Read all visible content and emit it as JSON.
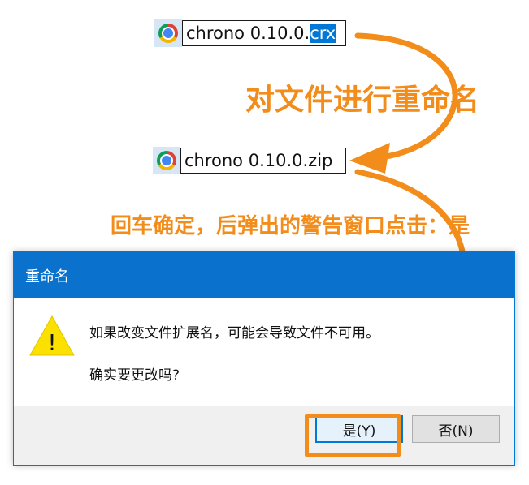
{
  "file_before": {
    "name_prefix": "chrono 0.10.0.",
    "extension_selected": "crx"
  },
  "file_after": {
    "name": "chrono 0.10.0.zip"
  },
  "annotations": {
    "step1": "对文件进行重命名",
    "step2": "回车确定，后弹出的警告窗口点击：是"
  },
  "dialog": {
    "title": "重命名",
    "message_line1": "如果改变文件扩展名，可能会导致文件不可用。",
    "message_line2": "确实要更改吗?",
    "warning_glyph": "!",
    "yes_label": "是(Y)",
    "no_label": "否(N)"
  },
  "colors": {
    "accent": "#f28c1a",
    "title_bar": "#0a72cc",
    "selection": "#0078d7"
  },
  "icons": [
    "chrome-icon",
    "warning-icon"
  ]
}
